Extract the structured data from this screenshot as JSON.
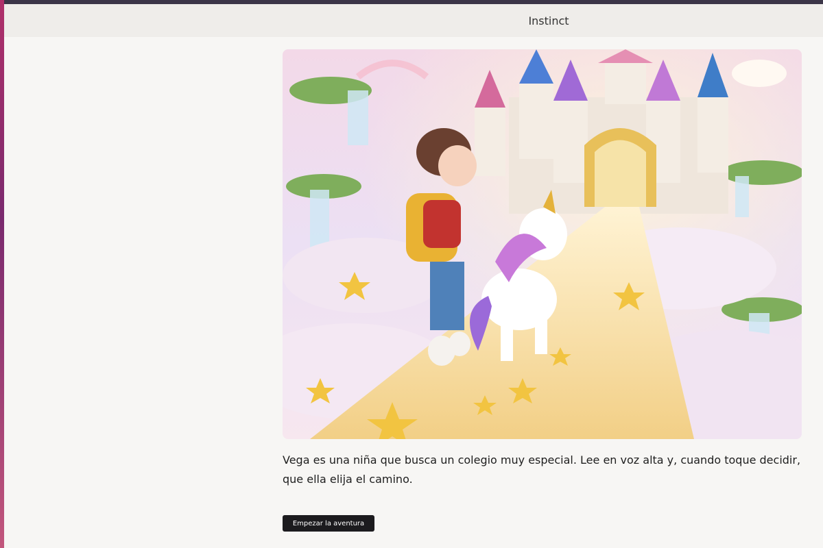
{
  "window": {
    "title": "Instinct"
  },
  "story": {
    "image_alt": "Girl with a red backpack and a rainbow unicorn walking on a starry cloud path toward a fairytale castle",
    "intro_text": "Vega es una niña que busca un colegio muy especial. Lee en voz alta y, cuando toque decidir, que ella elija el camino.",
    "start_button": "Empezar la aventura"
  }
}
